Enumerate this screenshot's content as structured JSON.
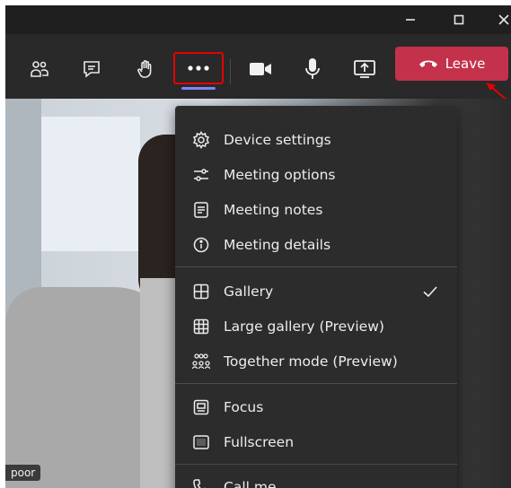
{
  "menu": {
    "items": [
      {
        "label": "Device settings"
      },
      {
        "label": "Meeting options"
      },
      {
        "label": "Meeting notes"
      },
      {
        "label": "Meeting details"
      },
      {
        "label": "Gallery",
        "checked": true
      },
      {
        "label": "Large gallery (Preview)"
      },
      {
        "label": "Together mode (Preview)"
      },
      {
        "label": "Focus"
      },
      {
        "label": "Fullscreen"
      },
      {
        "label": "Call me"
      }
    ]
  },
  "toolbar": {
    "leave_label": "Leave"
  },
  "video": {
    "name_tag": "poor"
  },
  "colors": {
    "leave": "#c4314b",
    "highlight": "#e60000",
    "accent": "#7f85f5",
    "menu_bg": "#2d2c2c"
  },
  "icons": [
    "minimize-icon",
    "maximize-icon",
    "close-icon",
    "participants-icon",
    "chat-icon",
    "raise-hand-icon",
    "more-actions-icon",
    "camera-icon",
    "microphone-icon",
    "share-screen-icon",
    "phone-hangup-icon",
    "gear-icon",
    "sliders-icon",
    "notes-icon",
    "info-icon",
    "gallery-icon",
    "large-gallery-icon",
    "together-mode-icon",
    "focus-icon",
    "fullscreen-icon",
    "phone-icon",
    "checkmark-icon"
  ]
}
